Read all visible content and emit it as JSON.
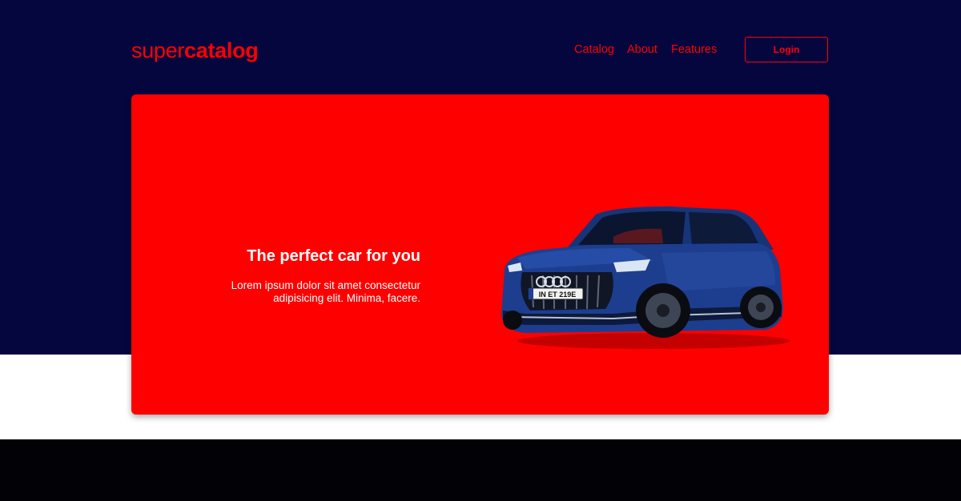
{
  "header": {
    "logo_light": "super",
    "logo_bold": "catalog",
    "nav": [
      {
        "label": "Catalog"
      },
      {
        "label": "About"
      },
      {
        "label": "Features"
      }
    ],
    "login_label": "Login"
  },
  "hero": {
    "title": "The perfect car for you",
    "text": "Lorem ipsum dolor sit amet consectetur adipisicing elit. Minima, facere.",
    "image": {
      "icon": "car-image",
      "license_plate": "IN ET 219E"
    }
  },
  "colors": {
    "navy": "#06063f",
    "accent": "#ff0000",
    "car_blue": "#1d3e8f",
    "footer": "#020206"
  }
}
